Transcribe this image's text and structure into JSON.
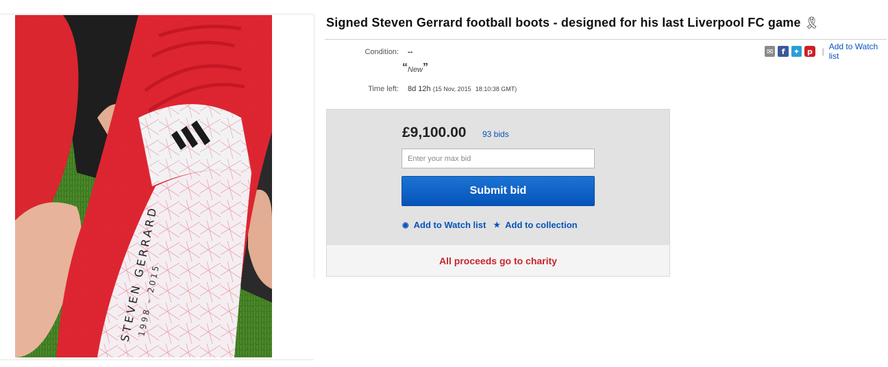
{
  "listing": {
    "title": "Signed Steven Gerrard football boots - designed for his last Liverpool FC game",
    "ribbon_icon": "🎗"
  },
  "details": {
    "condition_label": "Condition:",
    "condition_value": "--",
    "condition_quote": "New",
    "time_left_label": "Time left:",
    "time_left_value": "8d 12h",
    "time_left_date": "(15 Nov, 2015",
    "time_left_time": "18:10:38 GMT)"
  },
  "share": {
    "icons": [
      "mail-icon",
      "facebook-icon",
      "twitter-icon",
      "pinterest-icon"
    ],
    "separator": "|",
    "watch_link": "Add to Watch list"
  },
  "bid": {
    "price": "£9,100.00",
    "bid_count": "93 bids",
    "max_bid_placeholder": "Enter your max bid",
    "submit_label": "Submit bid",
    "watch_label": "Add to Watch list",
    "collection_label": "Add to collection",
    "charity_note": "All proceeds go to charity"
  },
  "photo": {
    "boot_print_name": "STEVEN GERRARD",
    "boot_print_years": "1998 – 2015"
  },
  "colors": {
    "link_blue": "#0654ba",
    "button_blue": "#0654ba",
    "charity_red": "#c8252c",
    "boot_red": "#e02a38"
  }
}
